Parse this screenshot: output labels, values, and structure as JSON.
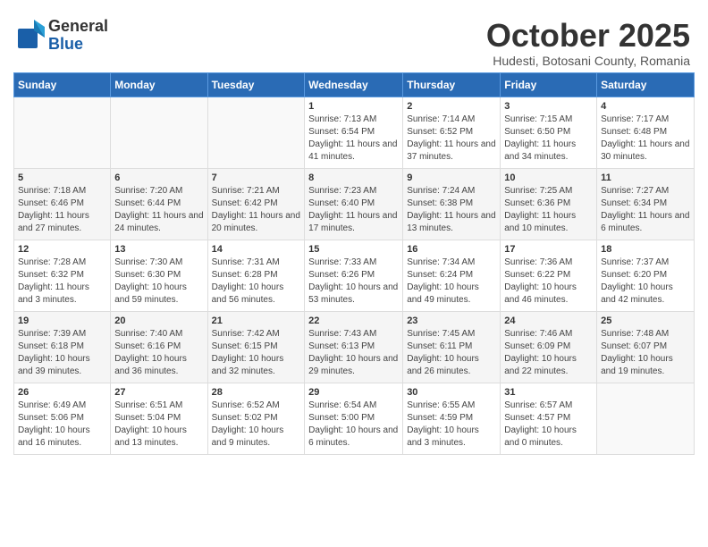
{
  "header": {
    "logo_general": "General",
    "logo_blue": "Blue",
    "month_title": "October 2025",
    "subtitle": "Hudesti, Botosani County, Romania"
  },
  "weekdays": [
    "Sunday",
    "Monday",
    "Tuesday",
    "Wednesday",
    "Thursday",
    "Friday",
    "Saturday"
  ],
  "weeks": [
    [
      {
        "day": "",
        "sunrise": "",
        "sunset": "",
        "daylight": ""
      },
      {
        "day": "",
        "sunrise": "",
        "sunset": "",
        "daylight": ""
      },
      {
        "day": "",
        "sunrise": "",
        "sunset": "",
        "daylight": ""
      },
      {
        "day": "1",
        "sunrise": "Sunrise: 7:13 AM",
        "sunset": "Sunset: 6:54 PM",
        "daylight": "Daylight: 11 hours and 41 minutes."
      },
      {
        "day": "2",
        "sunrise": "Sunrise: 7:14 AM",
        "sunset": "Sunset: 6:52 PM",
        "daylight": "Daylight: 11 hours and 37 minutes."
      },
      {
        "day": "3",
        "sunrise": "Sunrise: 7:15 AM",
        "sunset": "Sunset: 6:50 PM",
        "daylight": "Daylight: 11 hours and 34 minutes."
      },
      {
        "day": "4",
        "sunrise": "Sunrise: 7:17 AM",
        "sunset": "Sunset: 6:48 PM",
        "daylight": "Daylight: 11 hours and 30 minutes."
      }
    ],
    [
      {
        "day": "5",
        "sunrise": "Sunrise: 7:18 AM",
        "sunset": "Sunset: 6:46 PM",
        "daylight": "Daylight: 11 hours and 27 minutes."
      },
      {
        "day": "6",
        "sunrise": "Sunrise: 7:20 AM",
        "sunset": "Sunset: 6:44 PM",
        "daylight": "Daylight: 11 hours and 24 minutes."
      },
      {
        "day": "7",
        "sunrise": "Sunrise: 7:21 AM",
        "sunset": "Sunset: 6:42 PM",
        "daylight": "Daylight: 11 hours and 20 minutes."
      },
      {
        "day": "8",
        "sunrise": "Sunrise: 7:23 AM",
        "sunset": "Sunset: 6:40 PM",
        "daylight": "Daylight: 11 hours and 17 minutes."
      },
      {
        "day": "9",
        "sunrise": "Sunrise: 7:24 AM",
        "sunset": "Sunset: 6:38 PM",
        "daylight": "Daylight: 11 hours and 13 minutes."
      },
      {
        "day": "10",
        "sunrise": "Sunrise: 7:25 AM",
        "sunset": "Sunset: 6:36 PM",
        "daylight": "Daylight: 11 hours and 10 minutes."
      },
      {
        "day": "11",
        "sunrise": "Sunrise: 7:27 AM",
        "sunset": "Sunset: 6:34 PM",
        "daylight": "Daylight: 11 hours and 6 minutes."
      }
    ],
    [
      {
        "day": "12",
        "sunrise": "Sunrise: 7:28 AM",
        "sunset": "Sunset: 6:32 PM",
        "daylight": "Daylight: 11 hours and 3 minutes."
      },
      {
        "day": "13",
        "sunrise": "Sunrise: 7:30 AM",
        "sunset": "Sunset: 6:30 PM",
        "daylight": "Daylight: 10 hours and 59 minutes."
      },
      {
        "day": "14",
        "sunrise": "Sunrise: 7:31 AM",
        "sunset": "Sunset: 6:28 PM",
        "daylight": "Daylight: 10 hours and 56 minutes."
      },
      {
        "day": "15",
        "sunrise": "Sunrise: 7:33 AM",
        "sunset": "Sunset: 6:26 PM",
        "daylight": "Daylight: 10 hours and 53 minutes."
      },
      {
        "day": "16",
        "sunrise": "Sunrise: 7:34 AM",
        "sunset": "Sunset: 6:24 PM",
        "daylight": "Daylight: 10 hours and 49 minutes."
      },
      {
        "day": "17",
        "sunrise": "Sunrise: 7:36 AM",
        "sunset": "Sunset: 6:22 PM",
        "daylight": "Daylight: 10 hours and 46 minutes."
      },
      {
        "day": "18",
        "sunrise": "Sunrise: 7:37 AM",
        "sunset": "Sunset: 6:20 PM",
        "daylight": "Daylight: 10 hours and 42 minutes."
      }
    ],
    [
      {
        "day": "19",
        "sunrise": "Sunrise: 7:39 AM",
        "sunset": "Sunset: 6:18 PM",
        "daylight": "Daylight: 10 hours and 39 minutes."
      },
      {
        "day": "20",
        "sunrise": "Sunrise: 7:40 AM",
        "sunset": "Sunset: 6:16 PM",
        "daylight": "Daylight: 10 hours and 36 minutes."
      },
      {
        "day": "21",
        "sunrise": "Sunrise: 7:42 AM",
        "sunset": "Sunset: 6:15 PM",
        "daylight": "Daylight: 10 hours and 32 minutes."
      },
      {
        "day": "22",
        "sunrise": "Sunrise: 7:43 AM",
        "sunset": "Sunset: 6:13 PM",
        "daylight": "Daylight: 10 hours and 29 minutes."
      },
      {
        "day": "23",
        "sunrise": "Sunrise: 7:45 AM",
        "sunset": "Sunset: 6:11 PM",
        "daylight": "Daylight: 10 hours and 26 minutes."
      },
      {
        "day": "24",
        "sunrise": "Sunrise: 7:46 AM",
        "sunset": "Sunset: 6:09 PM",
        "daylight": "Daylight: 10 hours and 22 minutes."
      },
      {
        "day": "25",
        "sunrise": "Sunrise: 7:48 AM",
        "sunset": "Sunset: 6:07 PM",
        "daylight": "Daylight: 10 hours and 19 minutes."
      }
    ],
    [
      {
        "day": "26",
        "sunrise": "Sunrise: 6:49 AM",
        "sunset": "Sunset: 5:06 PM",
        "daylight": "Daylight: 10 hours and 16 minutes."
      },
      {
        "day": "27",
        "sunrise": "Sunrise: 6:51 AM",
        "sunset": "Sunset: 5:04 PM",
        "daylight": "Daylight: 10 hours and 13 minutes."
      },
      {
        "day": "28",
        "sunrise": "Sunrise: 6:52 AM",
        "sunset": "Sunset: 5:02 PM",
        "daylight": "Daylight: 10 hours and 9 minutes."
      },
      {
        "day": "29",
        "sunrise": "Sunrise: 6:54 AM",
        "sunset": "Sunset: 5:00 PM",
        "daylight": "Daylight: 10 hours and 6 minutes."
      },
      {
        "day": "30",
        "sunrise": "Sunrise: 6:55 AM",
        "sunset": "Sunset: 4:59 PM",
        "daylight": "Daylight: 10 hours and 3 minutes."
      },
      {
        "day": "31",
        "sunrise": "Sunrise: 6:57 AM",
        "sunset": "Sunset: 4:57 PM",
        "daylight": "Daylight: 10 hours and 0 minutes."
      },
      {
        "day": "",
        "sunrise": "",
        "sunset": "",
        "daylight": ""
      }
    ]
  ]
}
